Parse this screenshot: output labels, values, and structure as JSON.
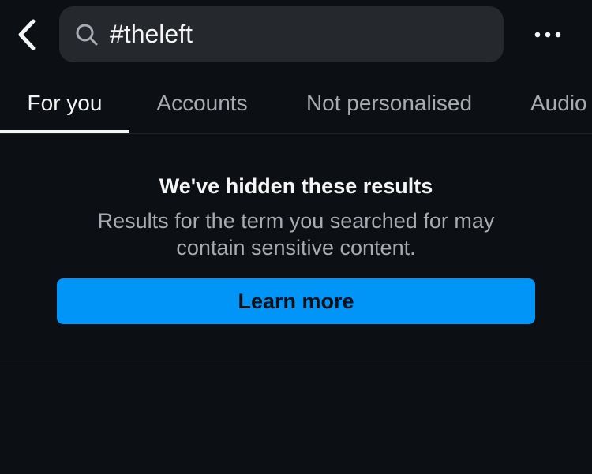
{
  "header": {
    "back_icon": "chevron-left-icon",
    "search": {
      "icon": "search-icon",
      "value": "#theleft"
    },
    "more_icon": "more-horizontal-icon"
  },
  "tabs": [
    {
      "label": "For you",
      "active": true
    },
    {
      "label": "Accounts",
      "active": false
    },
    {
      "label": "Not personalised",
      "active": false
    },
    {
      "label": "Audio",
      "active": false
    }
  ],
  "notice": {
    "title": "We've hidden these results",
    "body": "Results for the term you searched for may contain sensitive content.",
    "button_label": "Learn more"
  },
  "colors": {
    "background": "#0c1014",
    "search_background": "#25292e",
    "accent": "#0095f6",
    "primary_text": "#f5f5f5",
    "secondary_text": "#a8acb2"
  }
}
